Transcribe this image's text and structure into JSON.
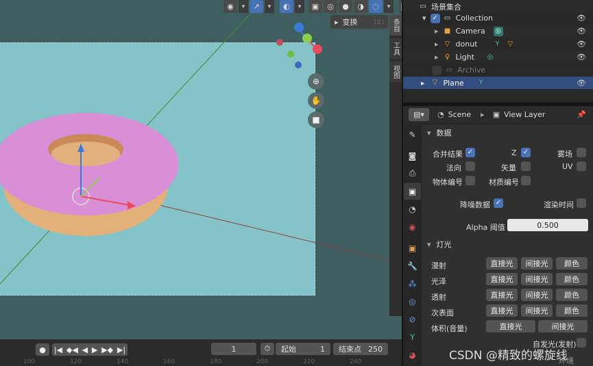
{
  "viewport": {
    "panel_tab_label": "变换",
    "side_tabs": [
      "条目",
      "工具",
      "视图"
    ],
    "nav_icons": [
      "zoom-icon",
      "hand-icon",
      "camera-icon"
    ]
  },
  "timeline": {
    "current_frame": "1",
    "start_label": "起始",
    "start_value": "1",
    "end_label": "结束点",
    "end_value": "250",
    "ruler_ticks": [
      "100",
      "120",
      "140",
      "160",
      "180",
      "200",
      "220",
      "240"
    ]
  },
  "outliner": {
    "rows": [
      {
        "label": "场景集合",
        "icon": "collection-icon"
      },
      {
        "label": "Collection",
        "icon": "collection-icon"
      },
      {
        "label": "Camera",
        "icon": "camera-icon"
      },
      {
        "label": "donut",
        "icon": "mesh-icon"
      },
      {
        "label": "Light",
        "icon": "light-icon"
      },
      {
        "label": "Archive",
        "icon": "collection-icon"
      },
      {
        "label": "Plane",
        "icon": "mesh-icon"
      }
    ]
  },
  "properties": {
    "scene_label": "Scene",
    "view_layer_label": "View Layer",
    "data_section": "数据",
    "light_section": "灯光",
    "data_fields": {
      "combined": "合并结果",
      "z": "Z",
      "mist": "雾场",
      "normal": "法向",
      "vector": "矢量",
      "uv": "UV",
      "object_index": "物体编号",
      "material_index": "材质编号",
      "denoise": "降噪数据",
      "render_time": "渲染时间",
      "alpha_label": "Alpha 阈值",
      "alpha_value": "0.500"
    },
    "light_rows": [
      {
        "label": "漫射",
        "buttons": [
          "直接光",
          "间接光",
          "颜色"
        ]
      },
      {
        "label": "光泽",
        "buttons": [
          "直接光",
          "间接光",
          "颜色"
        ]
      },
      {
        "label": "透射",
        "buttons": [
          "直接光",
          "间接光",
          "颜色"
        ]
      },
      {
        "label": "次表面",
        "buttons": [
          "直接光",
          "间接光",
          "颜色"
        ]
      },
      {
        "label": "体积(音量)",
        "buttons": [
          "直接光",
          "间接光"
        ]
      }
    ],
    "emission_label": "自发光(发射)",
    "last_partial": "环境"
  },
  "watermark": "CSDN @精致的螺旋线",
  "colors": {
    "accent": "#4772b3",
    "selected_row": "#334d80",
    "viewport": "#3f5e5f",
    "camera_frame": "#84c3c8"
  }
}
